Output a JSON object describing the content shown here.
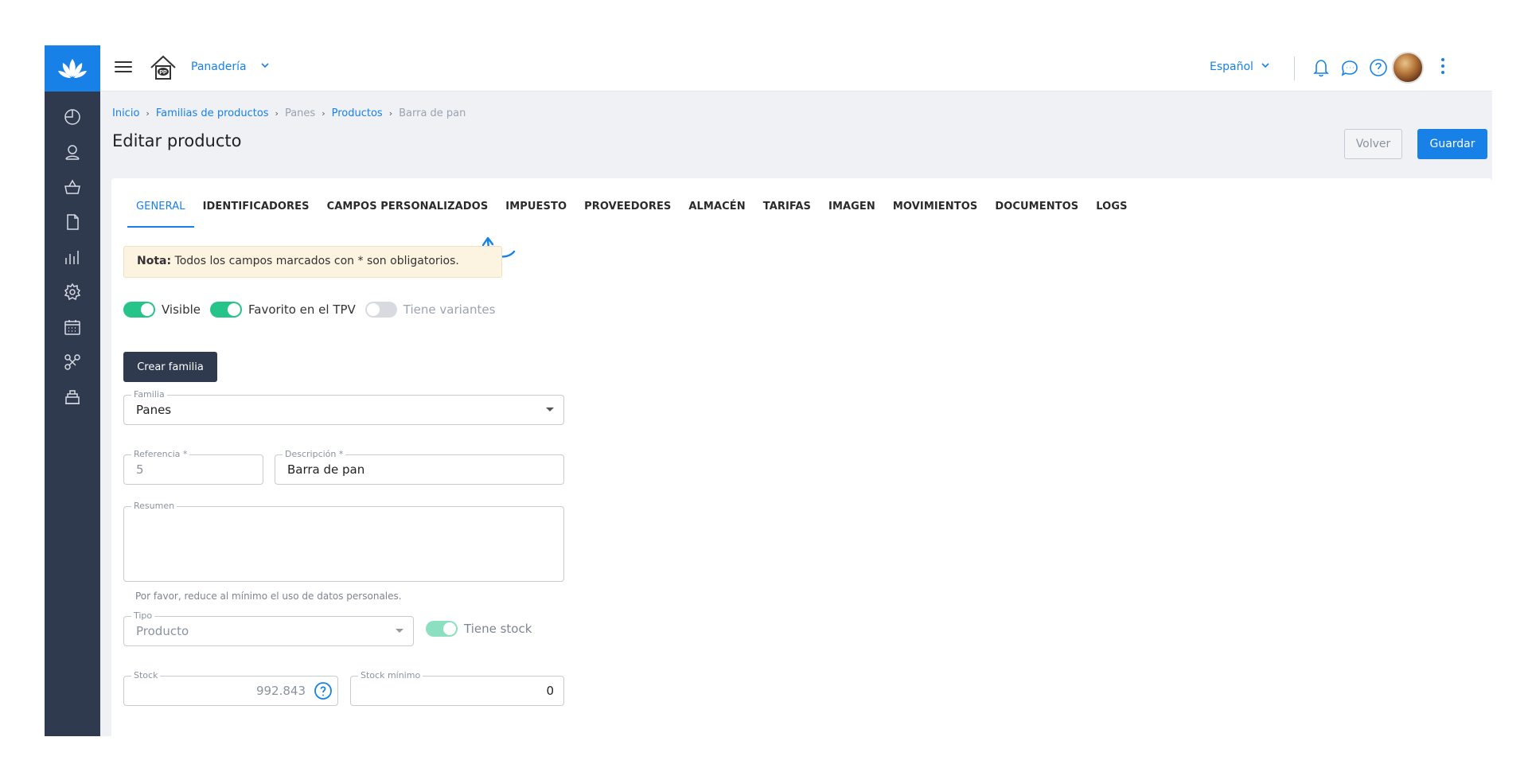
{
  "topbar": {
    "shop_name": "Panadería",
    "language": "Español"
  },
  "breadcrumb": [
    {
      "label": "Inicio",
      "link": true
    },
    {
      "label": "Familias de productos",
      "link": true
    },
    {
      "label": "Panes",
      "link": false
    },
    {
      "label": "Productos",
      "link": true
    },
    {
      "label": "Barra de pan",
      "link": false
    }
  ],
  "page": {
    "title": "Editar producto",
    "back_label": "Volver",
    "save_label": "Guardar"
  },
  "tabs": [
    "GENERAL",
    "IDENTIFICADORES",
    "CAMPOS PERSONALIZADOS",
    "IMPUESTO",
    "PROVEEDORES",
    "ALMACÉN",
    "TARIFAS",
    "IMAGEN",
    "MOVIMIENTOS",
    "DOCUMENTOS",
    "LOGS"
  ],
  "active_tab": "GENERAL",
  "note": {
    "bold": "Nota:",
    "text": " Todos los campos marcados con * son obligatorios."
  },
  "toggles": {
    "visible": {
      "label": "Visible",
      "on": true
    },
    "favorite": {
      "label": "Favorito en el TPV",
      "on": true
    },
    "variants": {
      "label": "Tiene variantes",
      "on": false
    }
  },
  "create_family_label": "Crear familia",
  "form": {
    "familia": {
      "label": "Familia",
      "value": "Panes"
    },
    "referencia": {
      "label": "Referencia *",
      "value": "5"
    },
    "descripcion": {
      "label": "Descripción *",
      "value": "Barra de pan"
    },
    "resumen": {
      "label": "Resumen",
      "value": ""
    },
    "resumen_hint": "Por favor, reduce al mínimo el uso de datos personales.",
    "tipo": {
      "label": "Tipo",
      "value": "Producto"
    },
    "tiene_stock": {
      "label": "Tiene stock",
      "on": true
    },
    "stock": {
      "label": "Stock",
      "value": "992.843"
    },
    "stock_minimo": {
      "label": "Stock mínimo",
      "value": "0"
    }
  },
  "colors": {
    "accent": "#1781e8",
    "sidebar": "#2f3a4f",
    "toggle_on": "#27c48a"
  }
}
